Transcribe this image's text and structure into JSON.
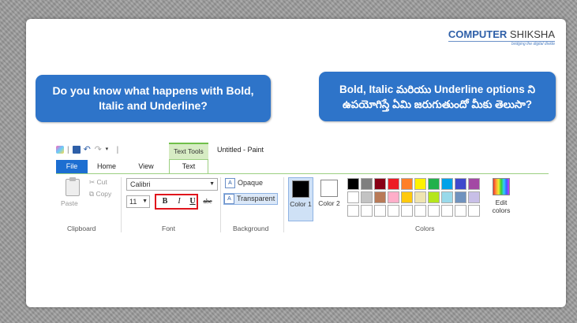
{
  "logo": {
    "main": "COMPUTER",
    "main2": " SHIKSHA",
    "tagline": "bridging the digital divide"
  },
  "callout_en": "Do you know what happens with Bold, Italic and Underline?",
  "callout_te": "Bold, Italic మరియు Underline options ని ఉపయోగిస్తే ఏమి జరుగుతుందో మీకు తెలుసా?",
  "paint": {
    "context_tab": "Text Tools",
    "doc_title": "Untitled - Paint",
    "tabs": {
      "file": "File",
      "home": "Home",
      "view": "View",
      "text": "Text"
    },
    "clipboard": {
      "paste": "Paste",
      "cut": "Cut",
      "copy": "Copy",
      "label": "Clipboard"
    },
    "font": {
      "family": "Calibri",
      "size": "11",
      "bold": "B",
      "italic": "I",
      "underline": "U",
      "strike": "abc",
      "label": "Font"
    },
    "background": {
      "opaque": "Opaque",
      "transparent": "Transparent",
      "label": "Background"
    },
    "colors": {
      "color1": "Color 1",
      "color2": "Color 2",
      "edit": "Edit colors",
      "label": "Colors",
      "color1_value": "#000000",
      "color2_value": "#ffffff",
      "palette": [
        "#000000",
        "#7f7f7f",
        "#880015",
        "#ed1c24",
        "#ff7f27",
        "#fff200",
        "#22b14c",
        "#00a2e8",
        "#3f48cc",
        "#a349a4",
        "#ffffff",
        "#c3c3c3",
        "#b97a57",
        "#ffaec9",
        "#ffc90e",
        "#efe4b0",
        "#b5e61d",
        "#99d9ea",
        "#7092be",
        "#c8bfe7",
        "#ffffff",
        "#ffffff",
        "#ffffff",
        "#ffffff",
        "#ffffff",
        "#ffffff",
        "#ffffff",
        "#ffffff",
        "#ffffff",
        "#ffffff"
      ]
    }
  }
}
